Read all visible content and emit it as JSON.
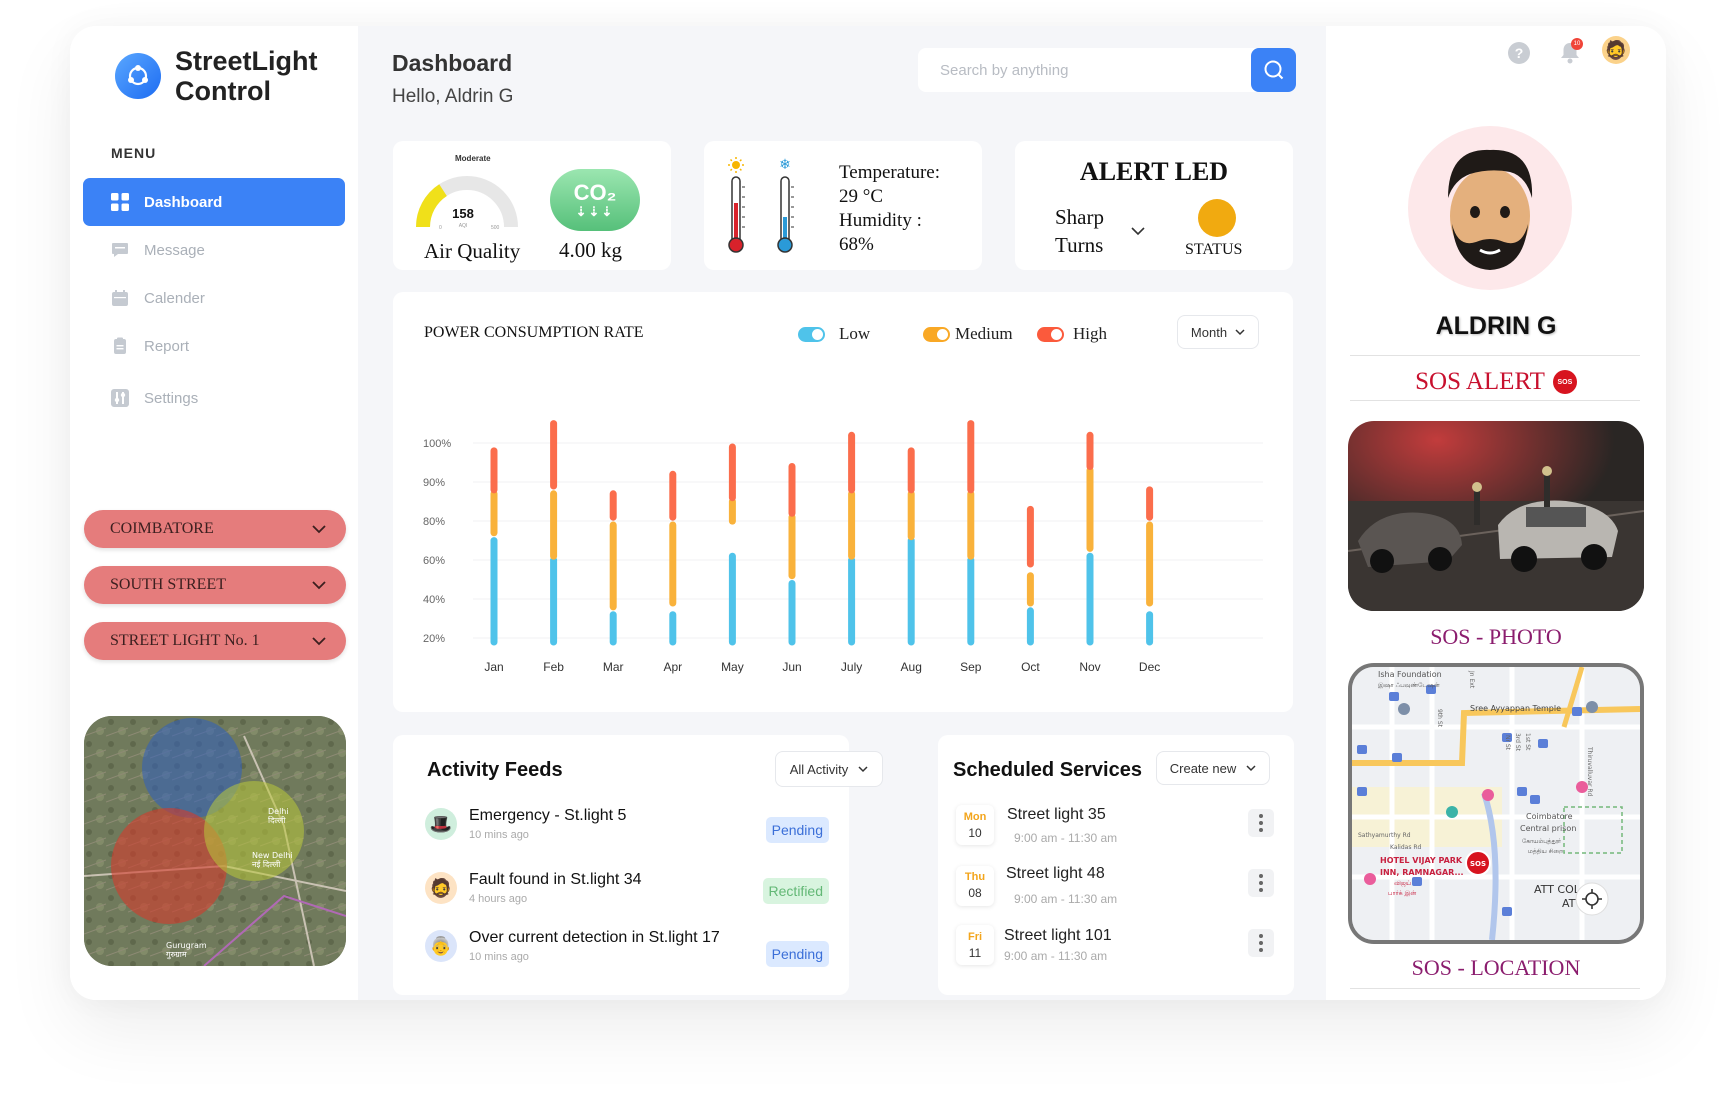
{
  "brand": {
    "line1": "StreetLight",
    "line2": "Control"
  },
  "menu": {
    "heading": "MENU",
    "items": [
      {
        "label": "Dashboard",
        "icon": "grid-icon"
      },
      {
        "label": "Message",
        "icon": "message-icon"
      },
      {
        "label": "Calender",
        "icon": "calendar-icon"
      },
      {
        "label": "Report",
        "icon": "report-icon"
      },
      {
        "label": "Settings",
        "icon": "settings-icon"
      }
    ]
  },
  "selectors": {
    "city": "COIMBATORE",
    "street": "SOUTH STREET",
    "light": "STREET LIGHT No. 1"
  },
  "map": {
    "label1": "Delhi",
    "label1b": "दिल्ली",
    "label2": "New Delhi",
    "label2b": "नई दिल्ली",
    "label3": "Gurugram",
    "label3b": "गुरुग्राम"
  },
  "header": {
    "title": "Dashboard",
    "greeting": "Hello, Aldrin G",
    "search_placeholder": "Search by anything"
  },
  "air": {
    "level": "Moderate",
    "aqi": "158",
    "unit": "AQI",
    "min": "0",
    "max": "500",
    "label": "Air Quality",
    "aqi_fraction": 0.316,
    "co2_badge": "CO₂",
    "co2_value": "4.00 kg"
  },
  "weather": {
    "temp_label": "Temperature:",
    "temp_value": "29 °C",
    "hum_label": "Humidity :",
    "hum_value": "68%"
  },
  "alert": {
    "title": "ALERT LED",
    "mode_line1": "Sharp",
    "mode_line2": "Turns",
    "status_label": "STATUS",
    "status_color": "#f1aa10"
  },
  "chart_data": {
    "type": "bar",
    "title": "POWER CONSUMPTION RATE",
    "legend": [
      "Low",
      "Medium",
      "High"
    ],
    "colors": {
      "low": "#4fc3ea",
      "medium": "#f9b23b",
      "high": "#fb6d4c"
    },
    "period": "Month",
    "categories": [
      "Jan",
      "Feb",
      "Mar",
      "Apr",
      "May",
      "Jun",
      "July",
      "Aug",
      "Sep",
      "Oct",
      "Nov",
      "Dec"
    ],
    "yticks": [
      "100%",
      "90%",
      "80%",
      "60%",
      "40%",
      "20%"
    ],
    "series": [
      {
        "name": "Low",
        "ranges": [
          [
            0,
            2.6
          ],
          [
            0,
            2.1
          ],
          [
            0,
            0.7
          ],
          [
            0,
            0.7
          ],
          [
            0,
            2.2
          ],
          [
            0,
            1.5
          ],
          [
            0,
            2.1
          ],
          [
            0,
            2.6
          ],
          [
            0,
            2.1
          ],
          [
            0,
            0.8
          ],
          [
            0,
            2.2
          ],
          [
            0,
            0.7
          ]
        ]
      },
      {
        "name": "Medium",
        "ranges": [
          [
            2.8,
            3.8
          ],
          [
            2.2,
            3.8
          ],
          [
            0.9,
            3.0
          ],
          [
            1.0,
            3.0
          ],
          [
            3.1,
            3.6
          ],
          [
            1.7,
            3.2
          ],
          [
            2.2,
            3.8
          ],
          [
            2.7,
            3.8
          ],
          [
            2.2,
            3.8
          ],
          [
            1.0,
            1.7
          ],
          [
            2.4,
            4.4
          ],
          [
            1.0,
            3.0
          ]
        ]
      },
      {
        "name": "High",
        "ranges": [
          [
            3.9,
            4.9
          ],
          [
            4.0,
            5.6
          ],
          [
            3.2,
            3.8
          ],
          [
            3.2,
            4.3
          ],
          [
            3.7,
            5.0
          ],
          [
            3.3,
            4.5
          ],
          [
            3.9,
            5.3
          ],
          [
            3.9,
            4.9
          ],
          [
            3.9,
            5.6
          ],
          [
            2.0,
            3.4
          ],
          [
            4.5,
            5.3
          ],
          [
            3.2,
            3.9
          ]
        ]
      }
    ]
  },
  "activity": {
    "title": "Activity Feeds",
    "filter": "All Activity",
    "items": [
      {
        "title": "Emergency - St.light 5",
        "time": "10 mins ago",
        "status": "Pending",
        "avatar": "🎩"
      },
      {
        "title": "Fault found in St.light 34",
        "time": "4 hours ago",
        "status": "Rectified",
        "avatar": "🧔"
      },
      {
        "title": "Over current detection in St.light 17",
        "time": "10 mins ago",
        "status": "Pending",
        "avatar": "👵"
      }
    ]
  },
  "services": {
    "title": "Scheduled Services",
    "action": "Create new",
    "items": [
      {
        "day": "Mon",
        "date": "10",
        "title": "Street light 35",
        "time": "9:00 am - 11:30 am"
      },
      {
        "day": "Thu",
        "date": "08",
        "title": "Street light 48",
        "time": "9:00 am - 11:30 am"
      },
      {
        "day": "Fri",
        "date": "11",
        "title": "Street light 101",
        "time": "9:00 am - 11:30 am"
      }
    ]
  },
  "topbar": {
    "notif_count": "10"
  },
  "profile": {
    "name": "ALDRIN G"
  },
  "sos": {
    "title": "SOS ALERT",
    "badge": "SOS",
    "photo_label": "SOS - PHOTO",
    "location_label": "SOS - LOCATION"
  },
  "location_map": {
    "p1": "Isha Foundation",
    "p1b": "இஷா ஃபவுண்டேஷன்",
    "p2": "Sree Ayyappan Temple",
    "p3": "Coimbatore",
    "p3b": "Central prison",
    "p3c": "கோயம்புத்தூர்",
    "p3d": "மத்திய சிறை",
    "p4": "HOTEL VIJAY PARK",
    "p4b": "INN, RAMNAGAR...",
    "p4c": "விஜய்",
    "p4d": "பார்க் இன்",
    "p5": "ATT COL",
    "p5b": "ATT",
    "p6": "Sathyamurthy Rd",
    "p7": "Kalidas Rd",
    "road1": "Thiruvalluvar Rd",
    "road2": "9th St",
    "road3": "3rd St",
    "road4": "1st St",
    "road5": "Nr St",
    "road6": "Jn Ext"
  }
}
